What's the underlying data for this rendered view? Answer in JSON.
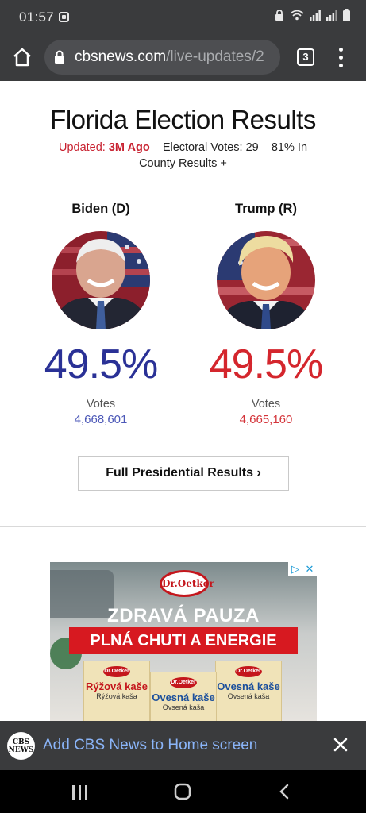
{
  "status_bar": {
    "time": "01:57"
  },
  "toolbar": {
    "url_domain": "cbsnews.com",
    "url_path": "/live-updates/2",
    "tab_count": "3"
  },
  "page": {
    "title": "Florida Election Results",
    "updated_label": "Updated:",
    "updated_value": "3M Ago",
    "electoral_votes": "Electoral Votes: 29",
    "reporting": "81% In",
    "county_results": "County Results +",
    "candidates": [
      {
        "name": "Biden (D)",
        "percent": "49.5%",
        "votes_label": "Votes",
        "votes": "4,668,601",
        "color": "#2a3196"
      },
      {
        "name": "Trump (R)",
        "percent": "49.5%",
        "votes_label": "Votes",
        "votes": "4,665,160",
        "color": "#d4262d"
      }
    ],
    "full_results_button": "Full Presidential Results ›"
  },
  "ad": {
    "brand": "Dr.Oetker",
    "headline": "ZDRAVÁ PAUZA",
    "band": "PLNÁ CHUTI A ENERGIE",
    "products": [
      {
        "name": "Rýžová kaše",
        "sub": "Rýžová kaša"
      },
      {
        "name": "Ovesná kaše",
        "sub": "Ovsená kaša"
      },
      {
        "name": "Ovesná kaše",
        "sub": "Ovsená kaša"
      }
    ]
  },
  "add_to_home": {
    "logo_text": "CBS NEWS",
    "text": "Add CBS News to Home screen"
  }
}
